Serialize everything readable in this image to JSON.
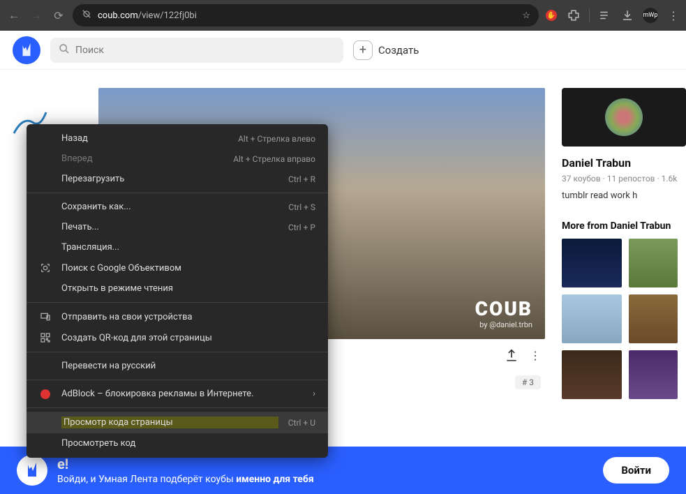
{
  "browser": {
    "url_prefix": "coub.com",
    "url_path": "/view/122fj0bi",
    "avatar_text": "mWp"
  },
  "header": {
    "search_placeholder": "Поиск",
    "create_label": "Создать"
  },
  "video": {
    "watermark_main": "COUB",
    "watermark_by": "by @daniel.trbn",
    "tag": "# 3"
  },
  "channel": {
    "name": "Daniel Trabun",
    "stats": "37 коубов · 11 репостов · 1.6k",
    "bio": "tumblr read work h",
    "more_title": "More from Daniel Trabun"
  },
  "banner": {
    "line1_visible": "e!",
    "line2_a": "Войди, и Умная Лента подберёт коубы ",
    "line2_b": "именно для тебя",
    "login": "Войти"
  },
  "menu": {
    "items": [
      {
        "label": "Назад",
        "shortcut": "Alt + Стрелка влево",
        "icon": ""
      },
      {
        "label": "Вперед",
        "shortcut": "Alt + Стрелка вправо",
        "icon": "",
        "disabled": true
      },
      {
        "label": "Перезагрузить",
        "shortcut": "Ctrl + R",
        "icon": ""
      },
      {
        "sep": true
      },
      {
        "label": "Сохранить как...",
        "shortcut": "Ctrl + S",
        "icon": ""
      },
      {
        "label": "Печать...",
        "shortcut": "Ctrl + P",
        "icon": ""
      },
      {
        "label": "Трансляция...",
        "shortcut": "",
        "icon": ""
      },
      {
        "label": "Поиск с Google Объективом",
        "shortcut": "",
        "icon": "lens"
      },
      {
        "label": "Открыть в режиме чтения",
        "shortcut": "",
        "icon": ""
      },
      {
        "sep": true
      },
      {
        "label": "Отправить на свои устройства",
        "shortcut": "",
        "icon": "devices"
      },
      {
        "label": "Создать QR-код для этой страницы",
        "shortcut": "",
        "icon": "qr"
      },
      {
        "sep": true
      },
      {
        "label": "Перевести на русский",
        "shortcut": "",
        "icon": ""
      },
      {
        "sep": true
      },
      {
        "label": "AdBlock – блокировка рекламы в Интернете.",
        "shortcut": "",
        "icon": "adblock",
        "chevron": true
      },
      {
        "sep": true
      },
      {
        "label": "Просмотр кода страницы",
        "shortcut": "Ctrl + U",
        "icon": "",
        "highlight": true
      },
      {
        "label": "Просмотреть код",
        "shortcut": "",
        "icon": ""
      }
    ]
  }
}
